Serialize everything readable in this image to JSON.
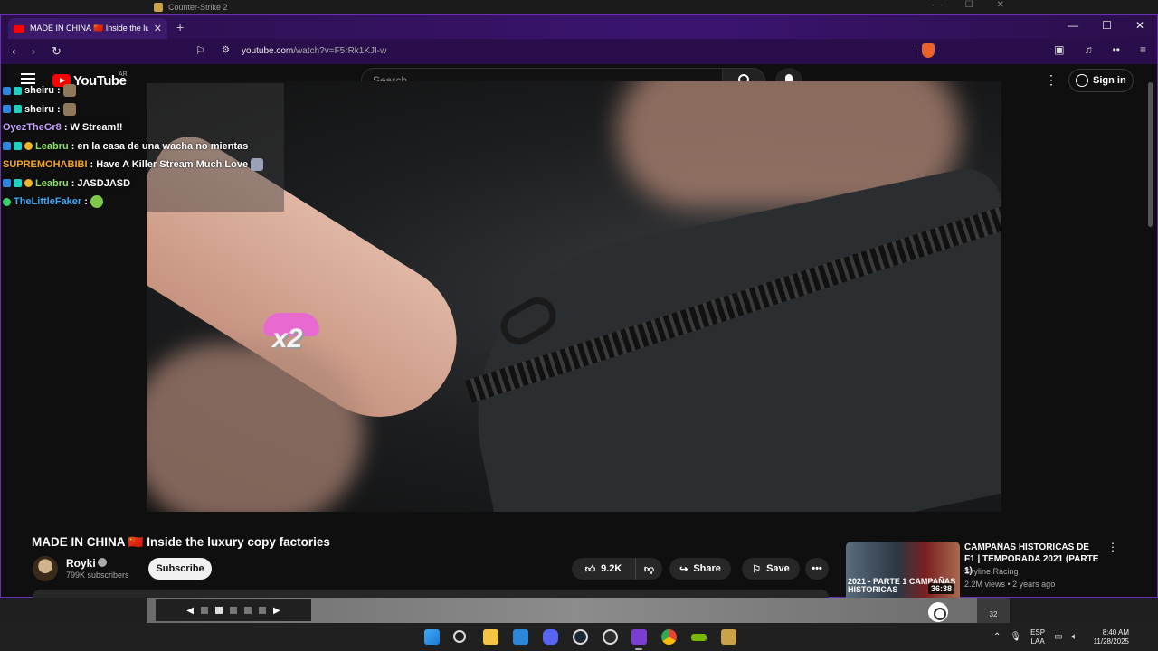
{
  "game_window": {
    "title": "Counter-Strike 2"
  },
  "browser": {
    "tab_title": "MADE IN CHINA 🇨🇳 Inside the lu",
    "url_domain": "youtube.com",
    "url_path": "/watch?v=F5rRk1KJI-w",
    "accent": "#6b2fb4"
  },
  "youtube": {
    "logo_text": "YouTube",
    "region": "AR",
    "search_placeholder": "Search",
    "sign_in": "Sign in"
  },
  "chat": [
    {
      "user": "sheiru",
      "color": "#ffffff",
      "text": "",
      "emote": "portrait",
      "badges": [
        "b1",
        "b2"
      ]
    },
    {
      "user": "sheiru",
      "color": "#ffffff",
      "text": "",
      "emote": "portrait",
      "badges": [
        "b1",
        "b2"
      ]
    },
    {
      "user": "OyezTheGr8",
      "color": "#c5a3ff",
      "text": "W Stream!!",
      "emote": "",
      "badges": []
    },
    {
      "user": "Leabru",
      "color": "#8fe36a",
      "text": "en la casa de una wacha no mientas",
      "emote": "",
      "badges": [
        "b1",
        "b2",
        "b3"
      ]
    },
    {
      "user": "SUPREMOHABIBI",
      "color": "#f5a623",
      "text": "Have A Killer Stream Much Love",
      "emote": "grey",
      "badges": []
    },
    {
      "user": "Leabru",
      "color": "#8fe36a",
      "text": "JASDJASD",
      "emote": "",
      "badges": [
        "b1",
        "b2",
        "b3"
      ]
    },
    {
      "user": "TheLittleFaker",
      "color": "#3fa9f5",
      "text": "",
      "emote": "green",
      "badges": [
        "b4"
      ]
    }
  ],
  "overlay_emote": {
    "text": "x2",
    "color": "#e86ad1"
  },
  "video": {
    "title": "MADE IN CHINA 🇨🇳 Inside the luxury copy factories",
    "channel": "Royki",
    "subscribers": "799K subscribers",
    "subscribe_label": "Subscribe",
    "likes": "9.2K",
    "share_label": "Share",
    "save_label": "Save"
  },
  "recommendation": {
    "title": "CAMPAÑAS HISTORICAS DE F1 | TEMPORADA 2021 (PARTE 1)",
    "channel": "Skyline Racing",
    "meta": "2.2M views • 2 years ago",
    "duration": "36:38",
    "thumb_text": "2021 - PARTE 1 CAMPAÑAS HISTORICAS"
  },
  "desktop": {
    "history_count": "32"
  },
  "taskbar": {
    "lang_line1": "ESP",
    "lang_line2": "LAA",
    "time": "8:40 AM",
    "date": "11/28/2025"
  }
}
